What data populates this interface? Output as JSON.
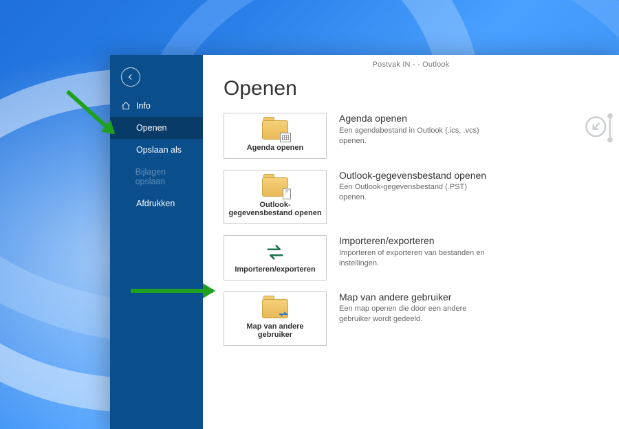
{
  "window": {
    "titlebar": "Postvak IN -                        - Outlook"
  },
  "page": {
    "title": "Openen"
  },
  "sidebar": {
    "items": [
      {
        "label": "Info",
        "icon": "home",
        "selected": false,
        "disabled": false
      },
      {
        "label": "Openen",
        "icon": "",
        "selected": true,
        "disabled": false
      },
      {
        "label": "Opslaan als",
        "icon": "",
        "selected": false,
        "disabled": false
      },
      {
        "label": "Bijlagen opslaan",
        "icon": "",
        "selected": false,
        "disabled": true
      },
      {
        "label": "Afdrukken",
        "icon": "",
        "selected": false,
        "disabled": false
      }
    ]
  },
  "options": [
    {
      "card_label": "Agenda openen",
      "title": "Agenda openen",
      "description": "Een agendabestand in Outlook (.ics, .vcs) openen.",
      "icon": "folder-calendar"
    },
    {
      "card_label": "Outlook-gegevensbestand openen",
      "title": "Outlook-gegevensbestand openen",
      "description": "Een Outlook-gegevensbestand (.PST) openen.",
      "icon": "folder-doc"
    },
    {
      "card_label": "Importeren/exporteren",
      "title": "Importeren/exporteren",
      "description": "Importeren of exporteren van bestanden en instellingen.",
      "icon": "import-export"
    },
    {
      "card_label": "Map van andere gebruiker",
      "title": "Map van andere gebruiker",
      "description": "Een map openen die door een andere gebruiker wordt gedeeld.",
      "icon": "folder-share"
    }
  ]
}
